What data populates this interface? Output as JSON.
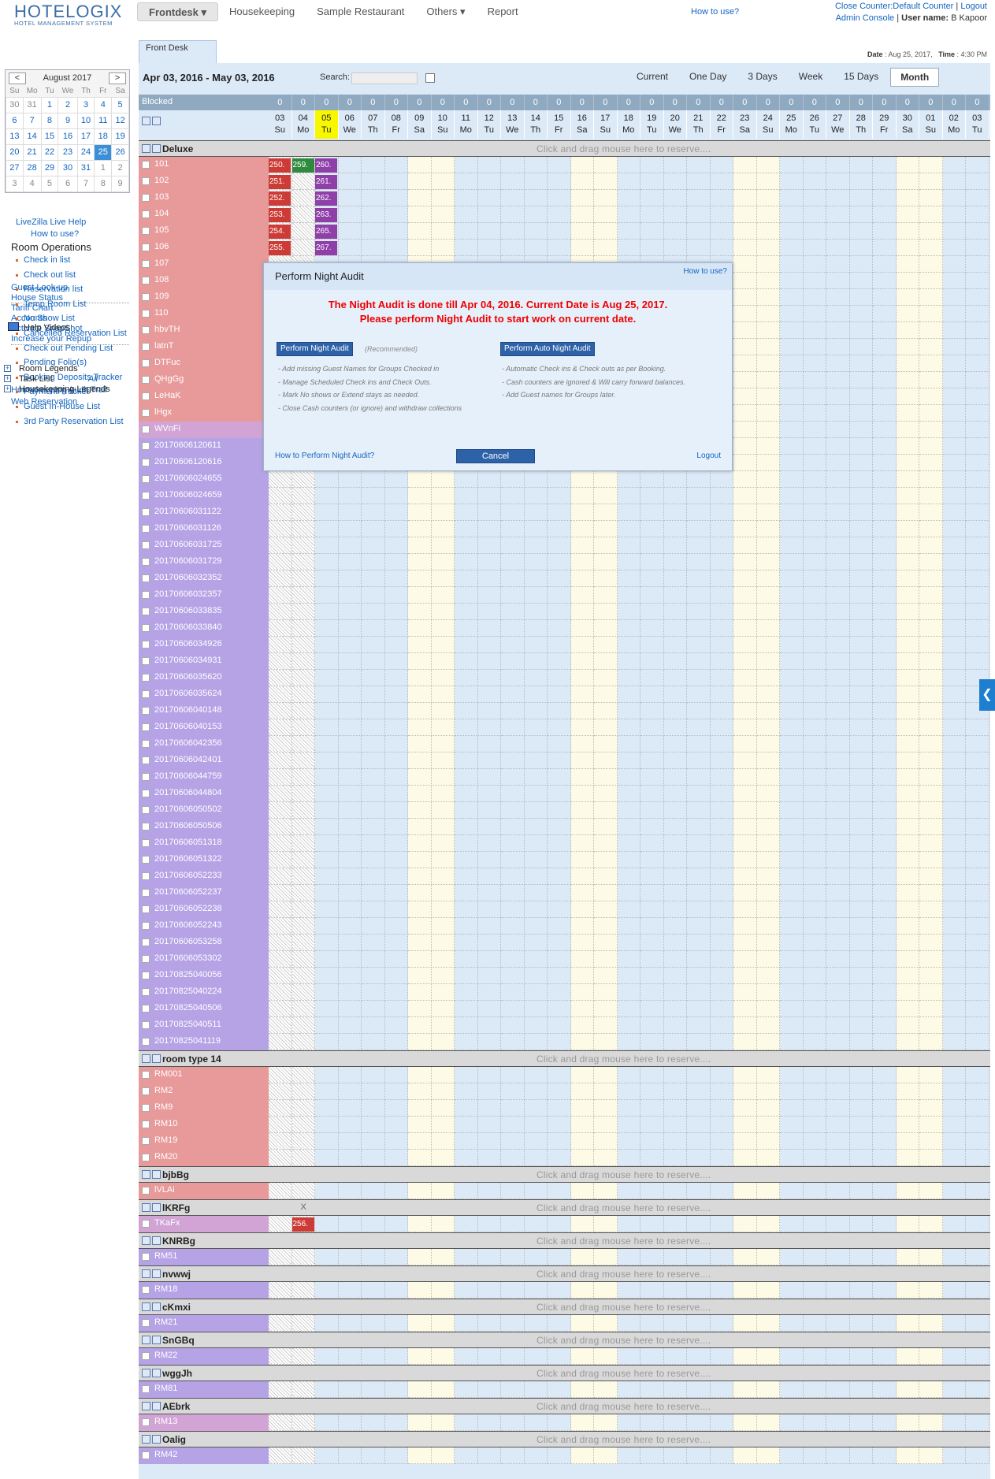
{
  "brand": {
    "name": "HOTELOGIX",
    "subtitle": "HOTEL MANAGEMENT SYSTEM"
  },
  "nav": {
    "items": [
      "Frontdesk",
      "Housekeeping",
      "Sample Restaurant",
      "Others",
      "Report"
    ],
    "active": "Frontdesk",
    "how_to_use": "How to use?"
  },
  "account": {
    "close_counter": "Close Counter:Default Counter",
    "logout": "Logout",
    "admin_console": "Admin Console",
    "user_label": "User name:",
    "user_name": "B Kapoor"
  },
  "datebar": {
    "date_label": "Date",
    "date": "Aug 25, 2017,",
    "time_label": "Time",
    "time": "4:30 PM"
  },
  "tab": {
    "front_desk": "Front Desk"
  },
  "calendar": {
    "month": "August 2017",
    "weekdays": [
      "Su",
      "Mo",
      "Tu",
      "We",
      "Th",
      "Fr",
      "Sa"
    ],
    "weeks": [
      [
        "30",
        "31",
        "1",
        "2",
        "3",
        "4",
        "5"
      ],
      [
        "6",
        "7",
        "8",
        "9",
        "10",
        "11",
        "12"
      ],
      [
        "13",
        "14",
        "15",
        "16",
        "17",
        "18",
        "19"
      ],
      [
        "20",
        "21",
        "22",
        "23",
        "24",
        "25",
        "26"
      ],
      [
        "27",
        "28",
        "29",
        "30",
        "31",
        "1",
        "2"
      ],
      [
        "3",
        "4",
        "5",
        "6",
        "7",
        "8",
        "9"
      ]
    ],
    "selected": "25"
  },
  "sidebar": {
    "livezilla": "LiveZilla Live Help",
    "how_to_use": "How to use?",
    "room_ops_title": "Room Operations",
    "room_ops": [
      "Check in list",
      "Check out list",
      "Reservation list",
      "Temp Room List",
      "No Show List",
      "Cancelled Reservation List",
      "Check out Pending List",
      "Pending Folio(s)",
      "Booking Deposits Tracker",
      "Payment Tracker",
      "Guest In-House List",
      "3rd Party Reservation List"
    ],
    "links": [
      "Guest Look-up",
      "House Status",
      "Tariff Chart",
      "Accounts",
      "Activate SnapShot",
      "Increase your Repup"
    ],
    "help_videos": "Help Videos",
    "legends": [
      "Room Legends",
      "Task List",
      "Housekeeping Legends"
    ],
    "task_all": "All",
    "bottom_links": [
      "Housekeeping Audit Trail",
      "Web Reservation"
    ]
  },
  "toolbar": {
    "range": "Apr 03, 2016 - May 03, 2016",
    "search_label": "Search:",
    "views": [
      "Current",
      "One Day",
      "3 Days",
      "Week",
      "15 Days",
      "Month"
    ],
    "active_view": "Month"
  },
  "grid": {
    "blocked_label": "Blocked",
    "blocked_counts": [
      "0",
      "0",
      "0",
      "0",
      "0",
      "0",
      "0",
      "0",
      "0",
      "0",
      "0",
      "0",
      "0",
      "0",
      "0",
      "0",
      "0",
      "0",
      "0",
      "0",
      "0",
      "0",
      "0",
      "0",
      "0",
      "0",
      "0",
      "0",
      "0",
      "0",
      "0"
    ],
    "dates": [
      [
        "03",
        "Su"
      ],
      [
        "04",
        "Mo"
      ],
      [
        "05",
        "Tu"
      ],
      [
        "06",
        "We"
      ],
      [
        "07",
        "Th"
      ],
      [
        "08",
        "Fr"
      ],
      [
        "09",
        "Sa"
      ],
      [
        "10",
        "Su"
      ],
      [
        "11",
        "Mo"
      ],
      [
        "12",
        "Tu"
      ],
      [
        "13",
        "We"
      ],
      [
        "14",
        "Th"
      ],
      [
        "15",
        "Fr"
      ],
      [
        "16",
        "Sa"
      ],
      [
        "17",
        "Su"
      ],
      [
        "18",
        "Mo"
      ],
      [
        "19",
        "Tu"
      ],
      [
        "20",
        "We"
      ],
      [
        "21",
        "Th"
      ],
      [
        "22",
        "Fr"
      ],
      [
        "23",
        "Sa"
      ],
      [
        "24",
        "Su"
      ],
      [
        "25",
        "Mo"
      ],
      [
        "26",
        "Tu"
      ],
      [
        "27",
        "We"
      ],
      [
        "28",
        "Th"
      ],
      [
        "29",
        "Fr"
      ],
      [
        "30",
        "Sa"
      ],
      [
        "01",
        "Su"
      ],
      [
        "02",
        "Mo"
      ],
      [
        "03",
        "Tu"
      ]
    ],
    "today_index": 2,
    "drag_hint": "Click and drag mouse here to reserve....",
    "groups": [
      {
        "name": "Deluxe",
        "rooms": [
          {
            "n": "101",
            "c": "pink",
            "b": [
              [
                "250.",
                0,
                "#cc3b35"
              ],
              [
                "259.",
                1,
                "#2e8b3e"
              ],
              [
                "260.",
                2,
                "#8e3fa8"
              ]
            ]
          },
          {
            "n": "102",
            "c": "pink",
            "b": [
              [
                "251.",
                0,
                "#cc3b35"
              ],
              [
                "261.",
                2,
                "#8e3fa8"
              ]
            ]
          },
          {
            "n": "103",
            "c": "pink",
            "b": [
              [
                "252.",
                0,
                "#cc3b35"
              ],
              [
                "262.",
                2,
                "#8e3fa8"
              ]
            ]
          },
          {
            "n": "104",
            "c": "pink",
            "b": [
              [
                "253.",
                0,
                "#cc3b35"
              ],
              [
                "263.",
                2,
                "#8e3fa8"
              ]
            ]
          },
          {
            "n": "105",
            "c": "pink",
            "b": [
              [
                "254.",
                0,
                "#cc3b35"
              ],
              [
                "265.",
                2,
                "#8e3fa8"
              ]
            ]
          },
          {
            "n": "106",
            "c": "pink",
            "b": [
              [
                "255.",
                0,
                "#cc3b35"
              ],
              [
                "267.",
                2,
                "#8e3fa8"
              ]
            ]
          },
          {
            "n": "107",
            "c": "pink"
          },
          {
            "n": "108",
            "c": "pink"
          },
          {
            "n": "109",
            "c": "pink"
          },
          {
            "n": "110",
            "c": "pink"
          },
          {
            "n": "hbvTH",
            "c": "pink"
          },
          {
            "n": "latnT",
            "c": "pink"
          },
          {
            "n": "DTFuc",
            "c": "pink"
          },
          {
            "n": "QHgGg",
            "c": "pink"
          },
          {
            "n": "LeHaK",
            "c": "pink"
          },
          {
            "n": "lHgx",
            "c": "pink"
          },
          {
            "n": "WVnFi",
            "c": "mauve"
          },
          {
            "n": "20170606120611",
            "c": "purple"
          },
          {
            "n": "20170606120616",
            "c": "purple"
          },
          {
            "n": "20170606024655",
            "c": "purple"
          },
          {
            "n": "20170606024659",
            "c": "purple"
          },
          {
            "n": "20170606031122",
            "c": "purple"
          },
          {
            "n": "20170606031126",
            "c": "purple"
          },
          {
            "n": "20170606031725",
            "c": "purple"
          },
          {
            "n": "20170606031729",
            "c": "purple"
          },
          {
            "n": "20170606032352",
            "c": "purple"
          },
          {
            "n": "20170606032357",
            "c": "purple"
          },
          {
            "n": "20170606033835",
            "c": "purple"
          },
          {
            "n": "20170606033840",
            "c": "purple"
          },
          {
            "n": "20170606034926",
            "c": "purple"
          },
          {
            "n": "20170606034931",
            "c": "purple"
          },
          {
            "n": "20170606035620",
            "c": "purple"
          },
          {
            "n": "20170606035624",
            "c": "purple"
          },
          {
            "n": "20170606040148",
            "c": "purple"
          },
          {
            "n": "20170606040153",
            "c": "purple"
          },
          {
            "n": "20170606042356",
            "c": "purple"
          },
          {
            "n": "20170606042401",
            "c": "purple"
          },
          {
            "n": "20170606044759",
            "c": "purple"
          },
          {
            "n": "20170606044804",
            "c": "purple"
          },
          {
            "n": "20170606050502",
            "c": "purple"
          },
          {
            "n": "20170606050506",
            "c": "purple"
          },
          {
            "n": "20170606051318",
            "c": "purple"
          },
          {
            "n": "20170606051322",
            "c": "purple"
          },
          {
            "n": "20170606052233",
            "c": "purple"
          },
          {
            "n": "20170606052237",
            "c": "purple"
          },
          {
            "n": "20170606052238",
            "c": "purple"
          },
          {
            "n": "20170606052243",
            "c": "purple"
          },
          {
            "n": "20170606053258",
            "c": "purple"
          },
          {
            "n": "20170606053302",
            "c": "purple"
          },
          {
            "n": "20170825040056",
            "c": "purple"
          },
          {
            "n": "20170825040224",
            "c": "purple"
          },
          {
            "n": "20170825040506",
            "c": "purple"
          },
          {
            "n": "20170825040511",
            "c": "purple"
          },
          {
            "n": "20170825041119",
            "c": "purple"
          }
        ]
      },
      {
        "name": "room type 14",
        "rooms": [
          {
            "n": "RM001",
            "c": "pink"
          },
          {
            "n": "RM2",
            "c": "pink"
          },
          {
            "n": "RM9",
            "c": "pink"
          },
          {
            "n": "RM10",
            "c": "pink"
          },
          {
            "n": "RM19",
            "c": "pink"
          },
          {
            "n": "RM20",
            "c": "pink"
          }
        ]
      },
      {
        "name": "bjbBg",
        "rooms": [
          {
            "n": "lVLAi",
            "c": "pink"
          }
        ]
      },
      {
        "name": "lKRFg",
        "x_mark": "X",
        "rooms": [
          {
            "n": "TKaFx",
            "c": "mauve",
            "b": [
              [
                "256.",
                1,
                "#cc3b35"
              ]
            ]
          }
        ]
      },
      {
        "name": "KNRBg",
        "rooms": [
          {
            "n": "RM51",
            "c": "purple"
          }
        ]
      },
      {
        "name": "nvwwj",
        "rooms": [
          {
            "n": "RM18",
            "c": "purple"
          }
        ]
      },
      {
        "name": "cKmxi",
        "rooms": [
          {
            "n": "RM21",
            "c": "purple"
          }
        ]
      },
      {
        "name": "SnGBq",
        "rooms": [
          {
            "n": "RM22",
            "c": "purple"
          }
        ]
      },
      {
        "name": "wggJh",
        "rooms": [
          {
            "n": "RM81",
            "c": "purple"
          }
        ]
      },
      {
        "name": "AEbrk",
        "rooms": [
          {
            "n": "RM13",
            "c": "mauve"
          }
        ]
      },
      {
        "name": "Oalig",
        "rooms": [
          {
            "n": "RM42",
            "c": "purple"
          }
        ]
      }
    ]
  },
  "modal": {
    "title": "Perform Night Audit",
    "how_to_use": "How to use?",
    "message_line1": "The Night Audit is done till Apr 04, 2016. Current Date is Aug 25, 2017.",
    "message_line2": "Please perform Night Audit to start work on current date.",
    "btn_manual": "Perform Night Audit",
    "recommended": "(Recommended)",
    "btn_auto": "Perform Auto Night Audit",
    "manual_notes": [
      "- Add missing Guest Names for Groups Checked in",
      "- Manage Scheduled Check ins and Check Outs.",
      "- Mark No shows or Extend stays as needed.",
      "- Close Cash counters (or ignore) and withdraw collections"
    ],
    "auto_notes": [
      "- Automatic Check ins & Check outs as per Booking.",
      "- Cash counters are ignored & Will carry forward balances.",
      "- Add Guest names for Groups later."
    ],
    "how_to_perform": "How to Perform Night Audit?",
    "cancel": "Cancel",
    "logout": "Logout"
  },
  "side_tab_glyph": "❮"
}
